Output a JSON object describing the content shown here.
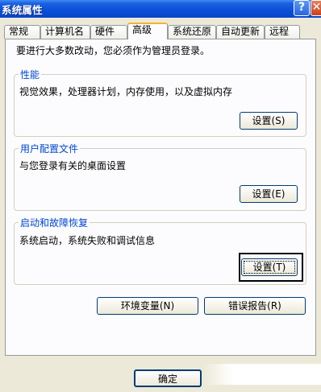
{
  "window": {
    "title": "系统属性",
    "help_glyph": "?",
    "close_glyph": "✕"
  },
  "tabs": [
    {
      "label": "常规"
    },
    {
      "label": "计算机名"
    },
    {
      "label": "硬件"
    },
    {
      "label": "高级"
    },
    {
      "label": "系统还原"
    },
    {
      "label": "自动更新"
    },
    {
      "label": "远程"
    }
  ],
  "admin_note": "要进行大多数改动，您必须作为管理员登录。",
  "groups": {
    "performance": {
      "title": "性能",
      "description": "视觉效果，处理器计划，内存使用，以及虚拟内存",
      "button": "设置(S)"
    },
    "profiles": {
      "title": "用户配置文件",
      "description": "与您登录有关的桌面设置",
      "button": "设置(E)"
    },
    "startup": {
      "title": "启动和故障恢复",
      "description": "系统启动，系统失败和调试信息",
      "button": "设置(T)"
    }
  },
  "buttons": {
    "env_vars": "环境变量(N)",
    "error_report": "错误报告(R)",
    "ok": "确定"
  },
  "colors": {
    "title_bar": "#0a4fd8",
    "group_title": "#0046d5",
    "active_tab_accent": "#f2b236",
    "dialog_bg": "#ece9d8"
  }
}
